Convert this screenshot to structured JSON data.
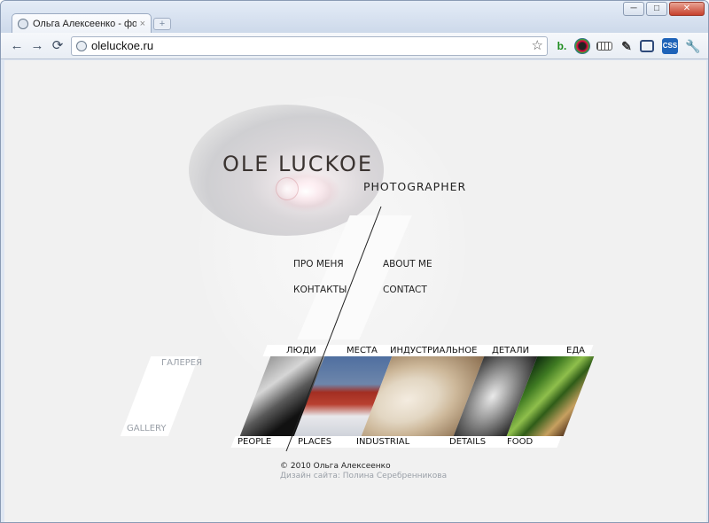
{
  "browser": {
    "tab_title": "Ольга Алексеенко - фотог",
    "tab_close": "×",
    "new_tab": "+",
    "window_minimize": "─",
    "window_maximize": "□",
    "window_close": "✕",
    "back": "←",
    "forward": "→",
    "reload": "⟳",
    "url": "oleluckoe.ru",
    "star": "☆",
    "extensions": [
      "bookmark-ext-icon",
      "color-ext-icon",
      "ruler-ext-icon",
      "eyedropper-ext-icon",
      "screenshot-ext-icon",
      "css-ext-icon",
      "wrench-icon"
    ]
  },
  "site": {
    "logo": "OLE LUCKOE",
    "subtitle": "PHOTOGRAPHER",
    "menu": {
      "about_ru": "ПРО МЕНЯ",
      "contacts_ru": "КОНТАКТЫ",
      "about_en": "ABOUT ME",
      "contact_en": "CONTACT"
    },
    "gallery_ru": "ГАЛЕРЕЯ",
    "gallery_en": "GALLERY",
    "categories": [
      {
        "ru": "ЛЮДИ",
        "en": "PEOPLE"
      },
      {
        "ru": "МЕСТА",
        "en": "PLACES"
      },
      {
        "ru": "ИНДУСТРИАЛЬНОЕ",
        "en": "INDUSTRIAL"
      },
      {
        "ru": "ДЕТАЛИ",
        "en": "DETAILS"
      },
      {
        "ru": "ЕДА",
        "en": "FOOD"
      }
    ],
    "copyright": "© 2010 Ольга Алексеенко",
    "design_credit": "Дизайн сайта: Полина Серебренникова"
  }
}
